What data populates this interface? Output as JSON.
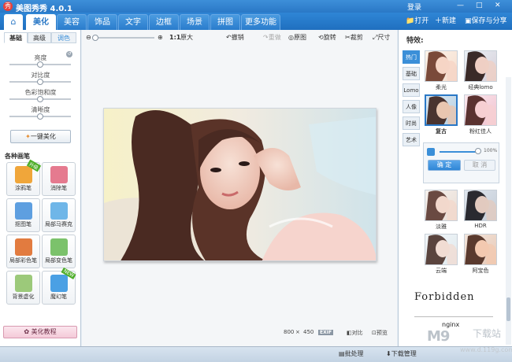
{
  "app": {
    "title": "美图秀秀 4.0.1",
    "logo_char": "秀"
  },
  "titlebar": {
    "login": "登录",
    "min": "—",
    "max": "□",
    "close": "✕"
  },
  "nav": {
    "home_icon": "house-icon",
    "tabs": [
      "美化",
      "美容",
      "饰品",
      "文字",
      "边框",
      "场景",
      "拼图",
      "更多功能 ▾"
    ],
    "open": "打开",
    "new": "新建",
    "save_share": "保存与分享"
  },
  "left": {
    "subtabs": [
      "基础",
      "高级",
      "调色"
    ],
    "sliders": [
      {
        "label": "亮度",
        "value": 0.5
      },
      {
        "label": "对比度",
        "value": 0.5
      },
      {
        "label": "色彩饱和度",
        "value": 0.5
      },
      {
        "label": "清晰度",
        "value": 0.5
      }
    ],
    "one_key": "一键美化",
    "section": "各种画笔",
    "tools": [
      {
        "label": "涂鸦笔",
        "color": "#f0a63a",
        "badge": "升级"
      },
      {
        "label": "消除笔",
        "color": "#e57a8f",
        "badge": ""
      },
      {
        "label": "抠图笔",
        "color": "#5e9fe0",
        "badge": ""
      },
      {
        "label": "局部马赛克",
        "color": "#6fb6e8",
        "badge": ""
      },
      {
        "label": "局部彩色笔",
        "color": "#e27b3f",
        "badge": ""
      },
      {
        "label": "局部变色笔",
        "color": "#7bc26b",
        "badge": ""
      },
      {
        "label": "背景虚化",
        "color": "#9cc97a",
        "badge": ""
      },
      {
        "label": "魔幻笔",
        "color": "#4aa0e4",
        "badge": "NEW"
      }
    ],
    "tutorial": "美化教程"
  },
  "canvas": {
    "zoom_label": "1:1",
    "original_size": "原大",
    "undo": "撤销",
    "redo": "重做",
    "original": "原图",
    "rotate": "旋转",
    "crop": "裁剪",
    "size": "尺寸",
    "dims_w": "800",
    "dims_x": "×",
    "dims_h": "450",
    "exif": "EXIF",
    "compare": "对比",
    "preview": "预览"
  },
  "right": {
    "title": "特效:",
    "categories": [
      "热门",
      "基础",
      "Lomo",
      "人像",
      "时尚",
      "艺术"
    ],
    "effects": [
      {
        "label": "柔光"
      },
      {
        "label": "经典lomo"
      },
      {
        "label": "复古",
        "selected": true
      },
      {
        "label": "粉红佳人"
      }
    ],
    "intensity": "100%",
    "confirm": "确 定",
    "cancel": "取 消",
    "effects2": [
      {
        "label": "淡雅"
      },
      {
        "label": "HDR"
      },
      {
        "label": "云端"
      },
      {
        "label": "阿宝色"
      }
    ],
    "text1": "Forbidden",
    "text2": "nginx"
  },
  "bottom": {
    "batch": "批处理",
    "download": "下载管理"
  },
  "watermark": {
    "main": "M9",
    "cn": "下载站",
    "url": "www.d.119g.com"
  },
  "colors": {
    "accent": "#2a78c6",
    "selected_tab": "#3b8fd8"
  }
}
